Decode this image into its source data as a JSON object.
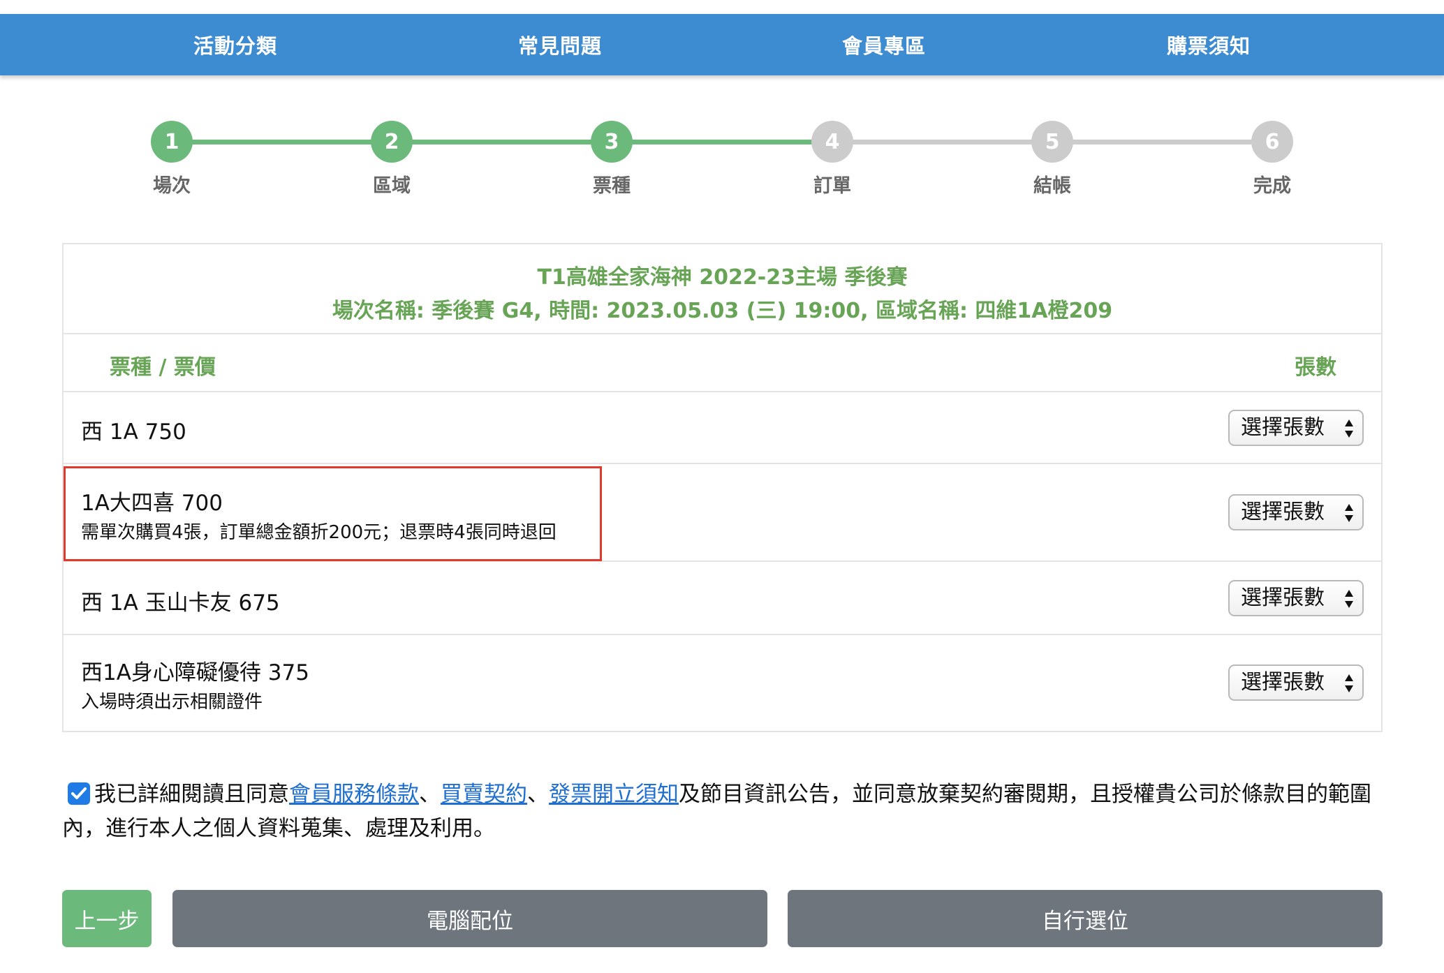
{
  "nav": {
    "items": [
      {
        "label": "活動分類"
      },
      {
        "label": "常見問題"
      },
      {
        "label": "會員專區"
      },
      {
        "label": "購票須知"
      }
    ]
  },
  "stepper": {
    "current_step": 3,
    "active_color": "#6cb97c",
    "inactive_color": "#cccccc",
    "steps": [
      {
        "num": "1",
        "label": "場次"
      },
      {
        "num": "2",
        "label": "區域"
      },
      {
        "num": "3",
        "label": "票種"
      },
      {
        "num": "4",
        "label": "訂單"
      },
      {
        "num": "5",
        "label": "結帳"
      },
      {
        "num": "6",
        "label": "完成"
      }
    ]
  },
  "event": {
    "title": "T1高雄全家海神 2022-23主場 季後賽",
    "details": "場次名稱: 季後賽 G4, 時間: 2023.05.03 (三) 19:00, 區域名稱: 四維1A橙209"
  },
  "table": {
    "col_ticket": "票種 / 票價",
    "col_qty": "張數",
    "select_label": "選擇張數",
    "rows": [
      {
        "name": "西 1A 750",
        "note": ""
      },
      {
        "name": "1A大四喜 700",
        "note": "需單次購買4張，訂單總金額折200元；退票時4張同時退回"
      },
      {
        "name": "西 1A 玉山卡友 675",
        "note": ""
      },
      {
        "name": "西1A身心障礙優待 375",
        "note": "入場時須出示相關證件"
      }
    ]
  },
  "agreement": {
    "checked": true,
    "prefix": "我已詳細閱讀且同意",
    "link1": "會員服務條款",
    "sep1": "、",
    "link2": "買賣契約",
    "sep2": "、",
    "link3": "發票開立須知",
    "suffix": "及節目資訊公告，並同意放棄契約審閱期，且授權貴公司於條款目的範圍內，進行本人之個人資料蒐集、處理及利用。"
  },
  "buttons": {
    "prev": "上一步",
    "auto_seat": "電腦配位",
    "self_seat": "自行選位"
  }
}
